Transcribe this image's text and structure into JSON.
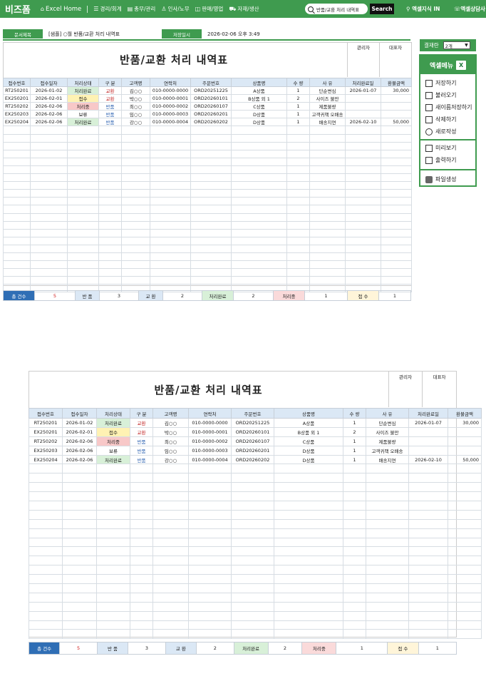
{
  "nav": {
    "brand": "비즈폼",
    "excel_home": "Excel Home",
    "items": [
      "경리/회계",
      "총무/관리",
      "인사/노무",
      "판매/영업",
      "자재/생산"
    ],
    "search_value": "반품/교환 처리 내역표",
    "search_button": "Search",
    "link_knowledge": "엑셀지식 IN",
    "link_consult": "엑셀상담사"
  },
  "doc": {
    "title_label": "문서제목",
    "title_value": "[샘플] ○월 반품/교환 처리 내역표",
    "saved_label": "저장일시",
    "saved_value": "2026-02-06  오후 3:49"
  },
  "sheet": {
    "title": "반품/교환 처리 내역표",
    "approver1": "관리자",
    "approver2": "대표자",
    "headers": [
      "접수번호",
      "접수일자",
      "처리상태",
      "구 분",
      "고객명",
      "연락처",
      "주문번호",
      "상품명",
      "수 량",
      "사 유",
      "처리완료일",
      "환불금액"
    ],
    "rows": [
      [
        "RT250201",
        "2026-01-02",
        "처리완료",
        "교환",
        "김○○",
        "010-0000-0000",
        "ORD20251225",
        "A상품",
        "1",
        "단순변심",
        "2026-01-07",
        "30,000"
      ],
      [
        "EX250201",
        "2026-02-01",
        "접수",
        "교환",
        "박○○",
        "010-0000-0001",
        "ORD20260101",
        "B상품 외 1",
        "2",
        "사이즈 불만",
        "",
        ""
      ],
      [
        "RT250202",
        "2026-02-06",
        "처리중",
        "반품",
        "최○○",
        "010-0000-0002",
        "ORD20260107",
        "C상품",
        "1",
        "제품불량",
        "",
        ""
      ],
      [
        "EX250203",
        "2026-02-06",
        "보류",
        "반품",
        "임○○",
        "010-0000-0003",
        "ORD20260201",
        "D상품",
        "1",
        "고객귀책 오배송",
        "",
        ""
      ],
      [
        "EX250204",
        "2026-02-06",
        "처리완료",
        "반품",
        "강○○",
        "010-0000-0004",
        "ORD20260202",
        "D상품",
        "1",
        "배송지연",
        "2026-02-10",
        "50,000"
      ]
    ],
    "summary": {
      "total_label": "총 건수",
      "total_value": "5",
      "return_label": "반 품",
      "return_value": "3",
      "exchange_label": "교 환",
      "exchange_value": "2",
      "done_label": "처리완료",
      "done_value": "2",
      "proc_label": "처리중",
      "proc_value": "1",
      "recv_label": "접 수",
      "recv_value": "1"
    }
  },
  "panel": {
    "pay_label": "결재란",
    "pay_select": "2개",
    "menu_title": "엑셀메뉴",
    "save": "저장하기",
    "load": "불러오기",
    "save_as": "새이름저장하기",
    "delete": "삭제하기",
    "new": "새로작성",
    "preview": "미리보기",
    "print": "출력하기",
    "file": "파일생성"
  }
}
